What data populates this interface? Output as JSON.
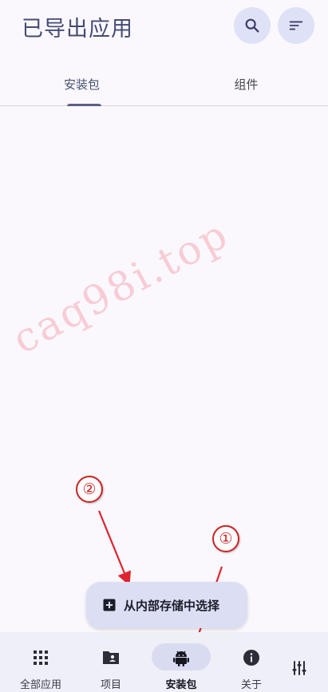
{
  "header": {
    "title": "已导出应用",
    "search_icon": "search-icon",
    "sort_icon": "sort-icon"
  },
  "tabs": [
    {
      "label": "安装包",
      "active": true
    },
    {
      "label": "组件",
      "active": false
    }
  ],
  "watermark": "caq98i.top",
  "annotations": {
    "marker_1": "①",
    "marker_2": "②",
    "arrow_color": "#e0242e"
  },
  "fab": {
    "label": "从内部存储中选择",
    "icon": "add-box-icon"
  },
  "bottom_nav": {
    "items": [
      {
        "label": "全部应用",
        "icon": "grid-icon",
        "active": false
      },
      {
        "label": "项目",
        "icon": "folder-account-icon",
        "active": false
      },
      {
        "label": "安装包",
        "icon": "android-icon",
        "active": true
      },
      {
        "label": "关于",
        "icon": "info-icon",
        "active": false
      }
    ],
    "settings_icon": "tune-icon"
  },
  "colors": {
    "background": "#faf8fd",
    "accent": "#5a6086",
    "title": "#454b73",
    "button_bg": "#dfe1f7",
    "nav_bg": "#efeff7"
  }
}
